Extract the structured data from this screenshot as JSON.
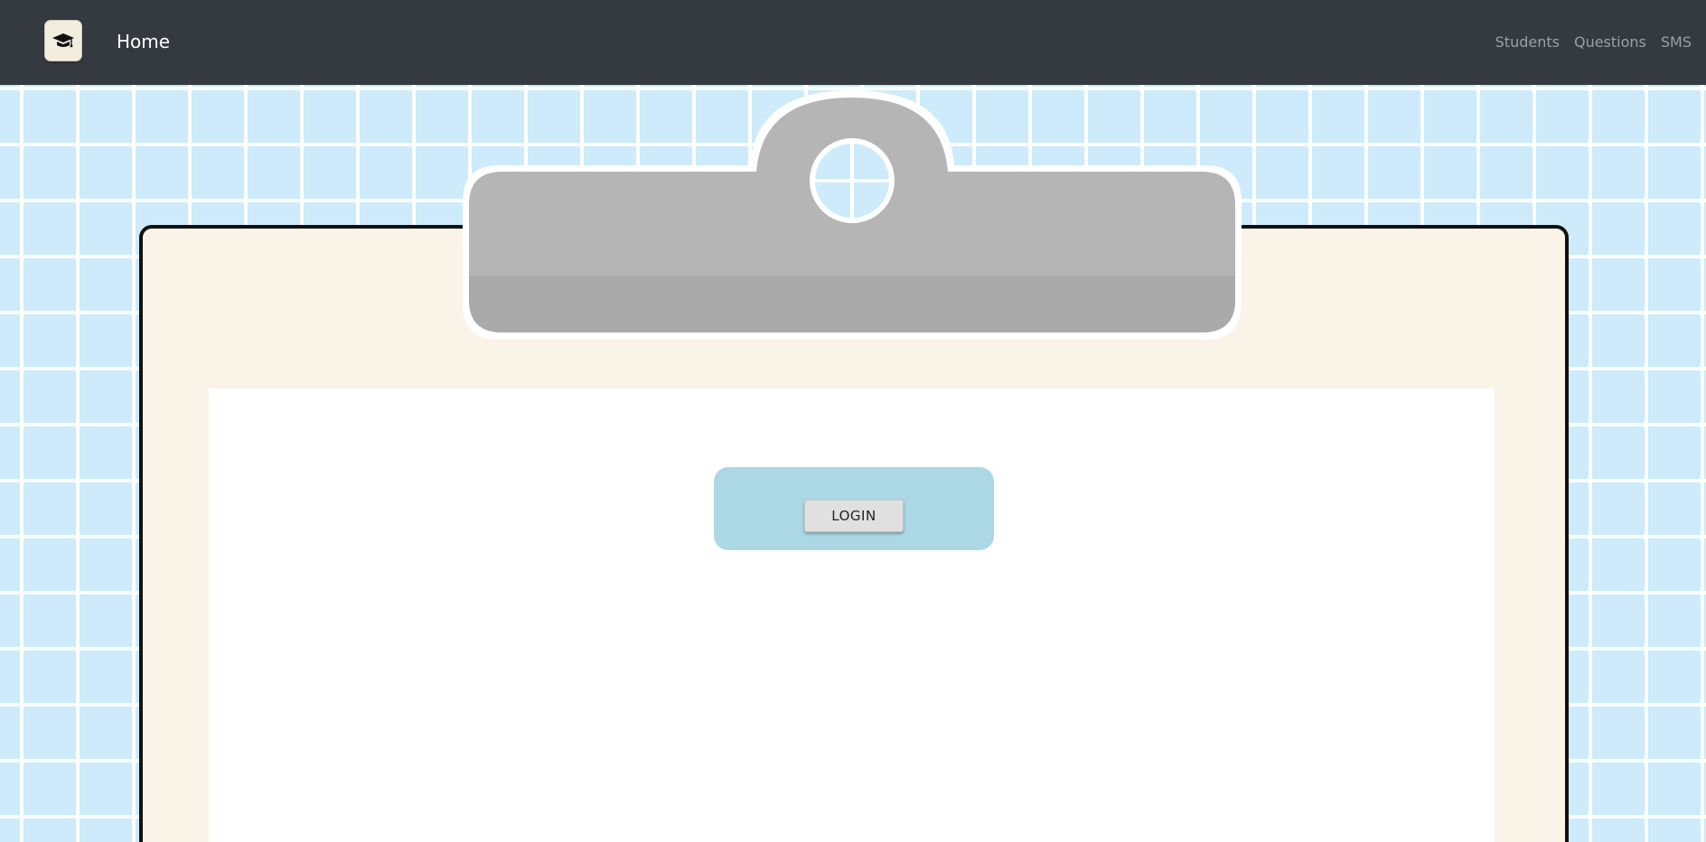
{
  "navbar": {
    "logo_icon": "graduation-cap-icon",
    "title": "Home",
    "links": [
      "Students",
      "Questions",
      "SMS"
    ],
    "background": "#343a40"
  },
  "main": {
    "login_button_label": "LOGIN"
  },
  "colors": {
    "page_background": "#cdebfa",
    "board": "#faf3e7",
    "clip": "#b5b5b5",
    "login_card": "#acd8e6"
  }
}
